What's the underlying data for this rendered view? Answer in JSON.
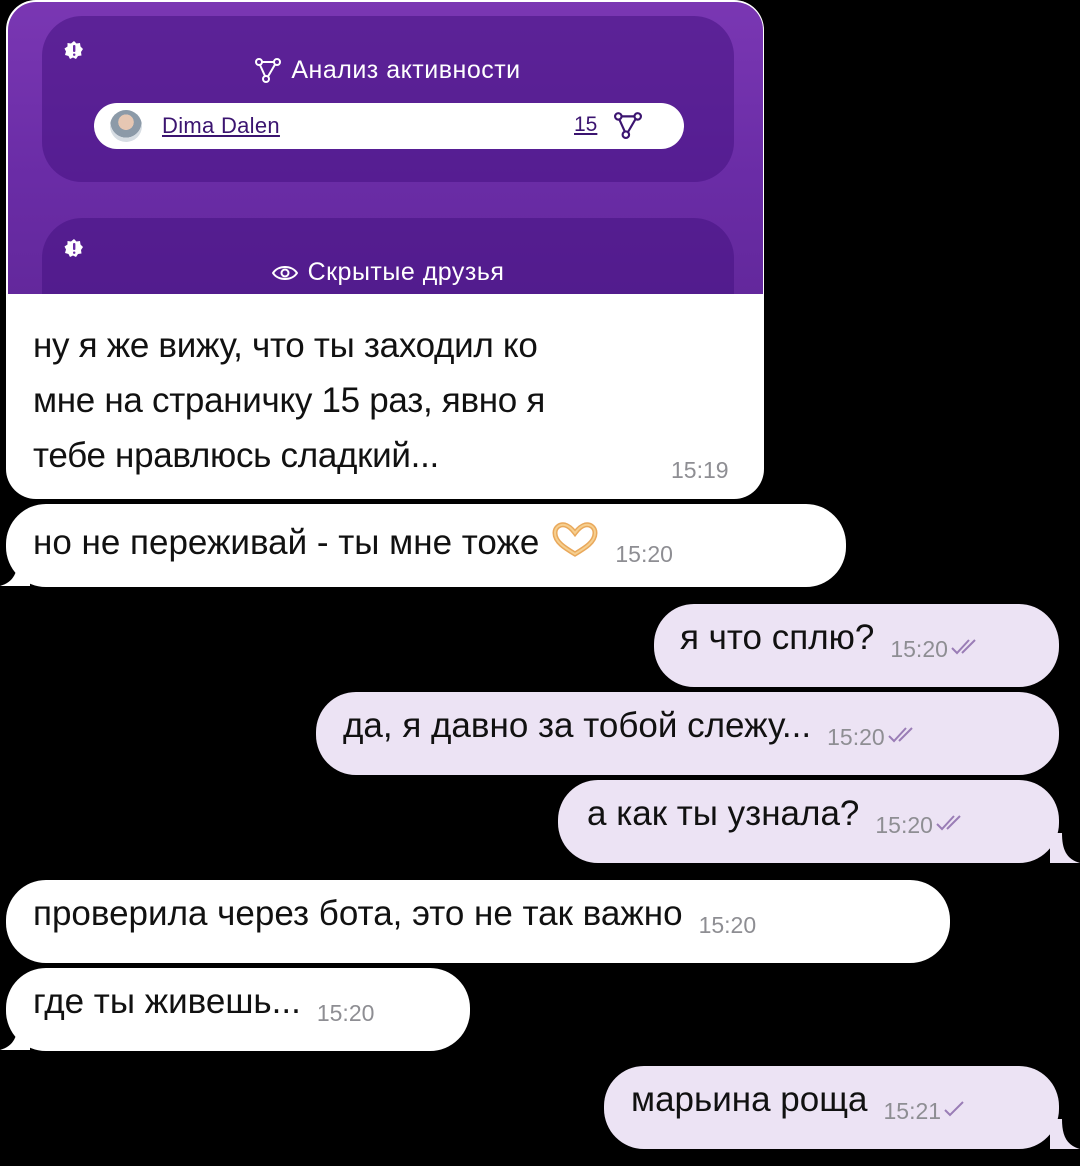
{
  "card": {
    "activity_title": "Анализ активности",
    "user_name": "Dima Dalen",
    "visit_count": "15",
    "hidden_friends_title": "Скрытые друзья",
    "text_line1": "ну я же вижу, что ты заходил ко",
    "text_line2": "мне на страничку 15 раз, явно я",
    "text_line3": "тебе нравлюсь сладкий...",
    "time": "15:19"
  },
  "messages": [
    {
      "text": "но не переживай - ты мне тоже",
      "emoji": "heart-hands-emoji",
      "time": "15:20",
      "direction": "incoming"
    },
    {
      "text": "я что сплю?",
      "time": "15:20",
      "direction": "outgoing",
      "status": "read"
    },
    {
      "text": "да, я давно за тобой слежу...",
      "time": "15:20",
      "direction": "outgoing",
      "status": "read"
    },
    {
      "text": "а как ты узнала?",
      "time": "15:20",
      "direction": "outgoing",
      "status": "read"
    },
    {
      "text": "проверила через бота, это не так важно",
      "time": "15:20",
      "direction": "incoming"
    },
    {
      "text": "где ты живешь...",
      "time": "15:20",
      "direction": "incoming"
    },
    {
      "text": "марьина роща",
      "time": "15:21",
      "direction": "outgoing",
      "status": "sent"
    }
  ],
  "colors": {
    "background": "#000000",
    "incoming_bubble": "#ffffff",
    "outgoing_bubble": "#ece3f4",
    "card_purple": "#6a2ca6",
    "outgoing_time": "#9a7db6"
  }
}
